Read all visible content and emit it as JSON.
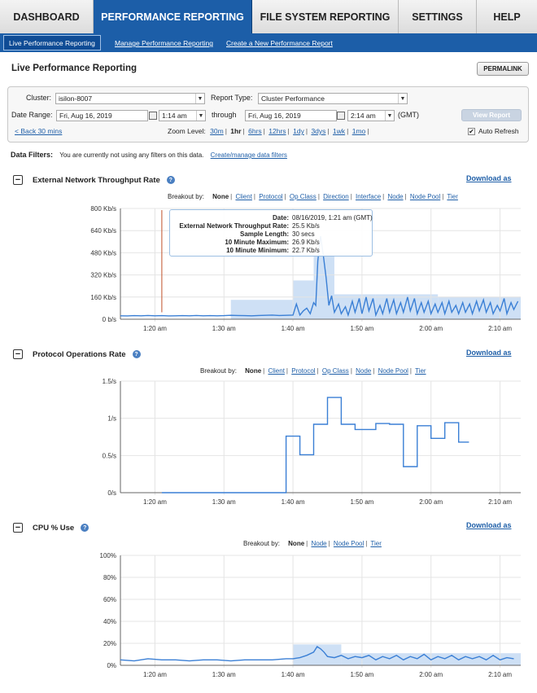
{
  "topnav": {
    "tabs": [
      {
        "label": "DASHBOARD",
        "active": false
      },
      {
        "label": "PERFORMANCE REPORTING",
        "active": true
      },
      {
        "label": "FILE SYSTEM REPORTING",
        "active": false
      },
      {
        "label": "SETTINGS",
        "active": false
      },
      {
        "label": "HELP",
        "active": false
      }
    ]
  },
  "subnav": {
    "items": [
      {
        "label": "Live Performance Reporting",
        "active": true
      },
      {
        "label": "Manage Performance Reporting",
        "active": false
      },
      {
        "label": "Create a New Performance Report",
        "active": false
      }
    ]
  },
  "page": {
    "title": "Live Performance Reporting",
    "permalink_label": "PERMALINK"
  },
  "controls": {
    "cluster_label": "Cluster:",
    "cluster_value": "isilon-8007",
    "report_type_label": "Report Type:",
    "report_type_value": "Cluster Performance",
    "date_range_label": "Date Range:",
    "start_date": "Fri, Aug 16, 2019",
    "start_time": "1:14 am",
    "through_label": "through",
    "end_date": "Fri, Aug 16, 2019",
    "end_time": "2:14 am",
    "tz_label": "(GMT)",
    "view_report_label": "View Report",
    "back_label": "< Back 30 mins",
    "zoom_label": "Zoom Level:",
    "zoom_levels": [
      "30m",
      "1hr",
      "6hrs",
      "12hrs",
      "1dy",
      "3dys",
      "1wk",
      "1mo"
    ],
    "zoom_selected": "1hr",
    "auto_refresh_label": "Auto Refresh",
    "auto_refresh_checked": true
  },
  "filters": {
    "label": "Data Filters:",
    "text": "You are currently not using any filters on this data.",
    "link": "Create/manage data filters"
  },
  "sections": [
    {
      "title": "External Network Throughput Rate",
      "download_label": "Download as",
      "breakout_label": "Breakout by:",
      "breakout_selected": "None",
      "breakout_options": [
        "Client",
        "Protocol",
        "Op Class",
        "Direction",
        "Interface",
        "Node",
        "Node Pool",
        "Tier"
      ]
    },
    {
      "title": "Protocol Operations Rate",
      "download_label": "Download as",
      "breakout_label": "Breakout by:",
      "breakout_selected": "None",
      "breakout_options": [
        "Client",
        "Protocol",
        "Op Class",
        "Node",
        "Node Pool",
        "Tier"
      ]
    },
    {
      "title": "CPU % Use",
      "download_label": "Download as",
      "breakout_label": "Breakout by:",
      "breakout_selected": "None",
      "breakout_options": [
        "Node",
        "Node Pool",
        "Tier"
      ]
    }
  ],
  "tooltip": {
    "rows": [
      {
        "k": "Date:",
        "v": "08/16/2019, 1:21 am (GMT)"
      },
      {
        "k": "External Network Throughput Rate:",
        "v": "25.5 Kb/s"
      },
      {
        "k": "Sample Length:",
        "v": "30 secs"
      },
      {
        "k": "10 Minute Maximum:",
        "v": "26.9 Kb/s"
      },
      {
        "k": "10 Minute Minimum:",
        "v": "22.7 Kb/s"
      }
    ]
  },
  "colors": {
    "nav_active": "#1c5ea8",
    "line": "#3a7fd5",
    "band": "#c6dbf3",
    "marker": "#c0502a"
  },
  "chart_data": [
    {
      "type": "line",
      "ylabel": "",
      "xlabel": "",
      "x_ticks": [
        "1:20 am",
        "1:30 am",
        "1:40 am",
        "1:50 am",
        "2:00 am",
        "2:10 am"
      ],
      "y_ticks": [
        "0 b/s",
        "160 Kb/s",
        "320 Kb/s",
        "480 Kb/s",
        "640 Kb/s",
        "800 Kb/s"
      ],
      "ylim": [
        0,
        800
      ],
      "y_unit": "Kb/s",
      "x_range_min": [
        15,
        73
      ],
      "series": [
        {
          "values_t": [
            15,
            16,
            17,
            18,
            19,
            20,
            21,
            22,
            23,
            24,
            25,
            26,
            27,
            28,
            29,
            30,
            31,
            32,
            33,
            34,
            35,
            36,
            37,
            38,
            39,
            40,
            40.5,
            41,
            41.5,
            42,
            42.5,
            43,
            43.3,
            43.6,
            44,
            44.4,
            44.8,
            45.2,
            45.6,
            46,
            46.6,
            47,
            47.6,
            48,
            48.6,
            49,
            49.6,
            50,
            50.6,
            51,
            51.6,
            52,
            52.6,
            53,
            53.6,
            54,
            54.6,
            55,
            55.6,
            56,
            56.6,
            57,
            57.6,
            58,
            58.6,
            59,
            59.6,
            60,
            60.6,
            61,
            61.6,
            62,
            62.6,
            63,
            63.6,
            64,
            64.6,
            65,
            65.6,
            66,
            66.6,
            67,
            67.6,
            68,
            68.6,
            69,
            69.6,
            70,
            70.6,
            71,
            71.6,
            72,
            72.6
          ],
          "values": [
            25,
            24,
            26,
            25,
            27,
            25,
            26,
            24,
            25,
            26,
            25,
            27,
            25,
            26,
            25,
            26,
            28,
            27,
            26,
            25,
            27,
            28,
            30,
            27,
            28,
            30,
            110,
            30,
            60,
            80,
            40,
            120,
            100,
            420,
            600,
            460,
            300,
            100,
            170,
            50,
            110,
            40,
            90,
            30,
            130,
            50,
            150,
            40,
            160,
            60,
            150,
            30,
            100,
            40,
            150,
            50,
            140,
            40,
            120,
            50,
            160,
            60,
            150,
            40,
            120,
            50,
            130,
            40,
            110,
            50,
            120,
            40,
            130,
            50,
            100,
            40,
            120,
            50,
            110,
            40,
            130,
            60,
            140,
            50,
            120,
            40,
            100,
            60,
            150,
            40,
            120,
            70,
            130
          ]
        }
      ],
      "bands": [
        {
          "x": [
            31,
            40
          ],
          "y": [
            0,
            140
          ]
        },
        {
          "x": [
            40,
            43
          ],
          "y": [
            0,
            280
          ]
        },
        {
          "x": [
            43,
            46
          ],
          "y": [
            0,
            470
          ]
        },
        {
          "x": [
            46,
            52
          ],
          "y": [
            0,
            180
          ]
        },
        {
          "x": [
            52,
            61
          ],
          "y": [
            0,
            180
          ]
        },
        {
          "x": [
            61,
            73
          ],
          "y": [
            0,
            160
          ]
        }
      ],
      "marker_t": 21
    },
    {
      "type": "line",
      "ylabel": "",
      "xlabel": "",
      "x_ticks": [
        "1:20 am",
        "1:30 am",
        "1:40 am",
        "1:50 am",
        "2:00 am",
        "2:10 am"
      ],
      "y_ticks": [
        "0/s",
        "0.5/s",
        "1/s",
        "1.5/s"
      ],
      "ylim": [
        0,
        1.5
      ],
      "x_range_min": [
        15,
        73
      ],
      "series": [
        {
          "values_t": [
            21,
            39,
            39,
            41,
            41,
            43,
            43,
            45,
            45,
            47,
            47,
            49,
            49,
            52,
            52,
            54,
            54,
            56,
            56,
            58,
            58,
            60,
            60,
            62,
            62,
            64,
            64,
            65.5
          ],
          "values": [
            0,
            0,
            0.76,
            0.76,
            0.51,
            0.51,
            0.92,
            0.92,
            1.28,
            1.28,
            0.92,
            0.92,
            0.85,
            0.85,
            0.93,
            0.93,
            0.92,
            0.92,
            0.35,
            0.35,
            0.9,
            0.9,
            0.73,
            0.73,
            0.94,
            0.94,
            0.68,
            0.68
          ]
        }
      ]
    },
    {
      "type": "line",
      "ylabel": "",
      "xlabel": "",
      "x_ticks": [
        "1:20 am",
        "1:30 am",
        "1:40 am",
        "1:50 am",
        "2:00 am",
        "2:10 am"
      ],
      "y_ticks": [
        "0%",
        "20%",
        "40%",
        "60%",
        "80%",
        "100%"
      ],
      "ylim": [
        0,
        100
      ],
      "x_range_min": [
        15,
        73
      ],
      "series": [
        {
          "values_t": [
            15,
            17,
            19,
            21,
            23,
            25,
            27,
            29,
            31,
            33,
            35,
            37,
            39,
            40,
            41,
            42,
            43,
            43.5,
            44,
            44.5,
            45,
            46,
            47,
            48,
            49,
            50,
            51,
            52,
            53,
            54,
            55,
            56,
            57,
            58,
            59,
            60,
            61,
            62,
            63,
            64,
            65,
            66,
            67,
            68,
            69,
            70,
            71,
            72
          ],
          "values": [
            5,
            4,
            6,
            5,
            5,
            4,
            5,
            5,
            4,
            5,
            5,
            5,
            6,
            6,
            7,
            9,
            12,
            17,
            15,
            12,
            8,
            7,
            9,
            6,
            8,
            7,
            9,
            5,
            8,
            6,
            9,
            5,
            8,
            6,
            10,
            5,
            8,
            6,
            9,
            5,
            8,
            6,
            8,
            5,
            9,
            5,
            7,
            6
          ]
        }
      ],
      "bands": [
        {
          "x": [
            40,
            47
          ],
          "y": [
            0,
            19
          ]
        },
        {
          "x": [
            47,
            73
          ],
          "y": [
            0,
            11
          ]
        }
      ]
    }
  ]
}
